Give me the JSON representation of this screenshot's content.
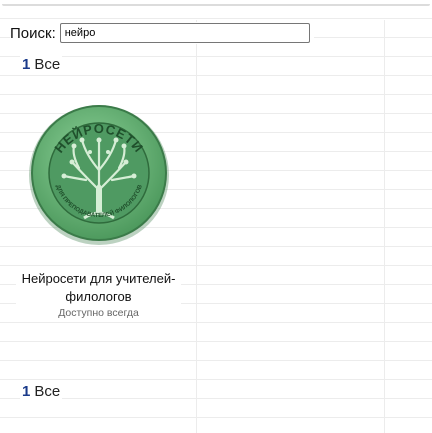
{
  "search": {
    "label": "Поиск:",
    "value": "нейро"
  },
  "pager_top": {
    "page_number": "1",
    "all_label": "Все"
  },
  "card": {
    "title": "Нейросети для учителей-филологов",
    "status": "Доступно всегда",
    "logo_text_top": "НЕЙРОСЕТИ",
    "logo_text_bottom": "ДЛЯ ПРЕПОДАВАТЕЛЕЙ ФИЛОЛОГОВ",
    "colors": {
      "outer": "#6fbf7a",
      "inner": "#4f9a62",
      "tree": "#cfe8cf"
    }
  },
  "pager_bottom": {
    "page_number": "1",
    "all_label": "Все"
  }
}
